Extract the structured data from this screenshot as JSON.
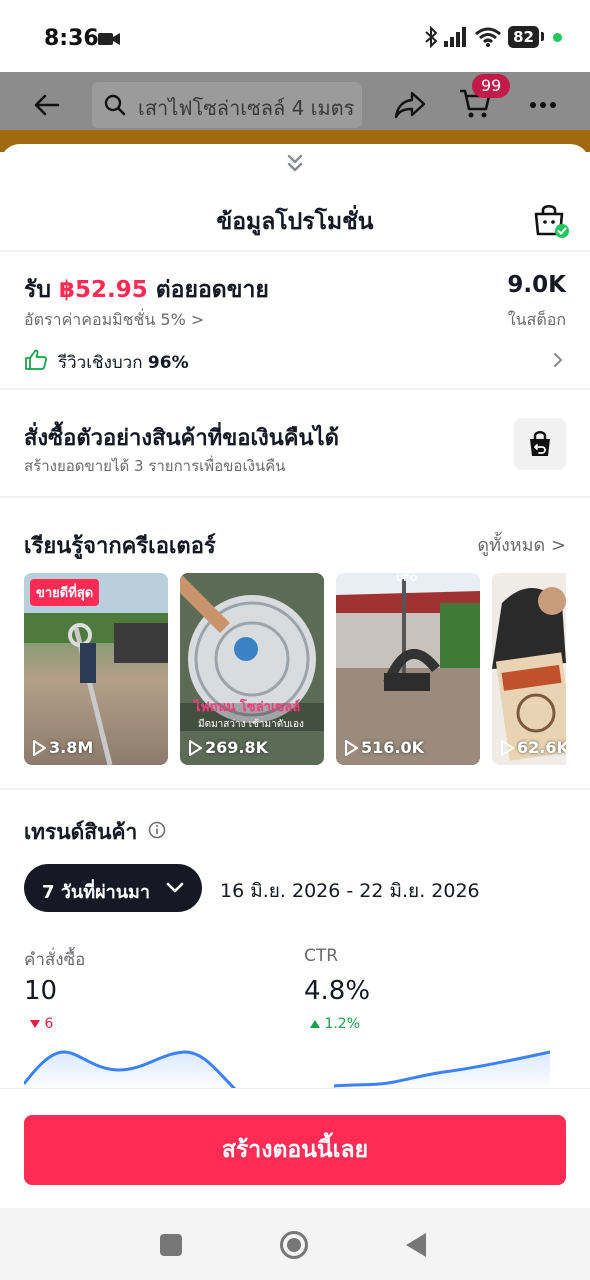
{
  "status_bar": {
    "time": "8:36",
    "battery": "82",
    "icons": [
      "camera-icon",
      "bluetooth-icon",
      "signal-icon",
      "wifi-icon",
      "battery-icon"
    ]
  },
  "top_nav": {
    "search_text": "เสาไฟโซล่าเซลล์ 4 เมตร",
    "cart_badge": "99",
    "icons": [
      "back-icon",
      "search-icon",
      "share-icon",
      "cart-icon",
      "more-icon"
    ]
  },
  "sheet": {
    "title": "ข้อมูลโปรโมชั่น",
    "earn_prefix": "รับ ",
    "earn_amount": "฿52.95",
    "earn_suffix": " ต่อยอดขาย",
    "commission": "อัตราค่าคอมมิชชั่น 5% >",
    "stock_count": "9.0K",
    "stock_label": "ในสต็อก",
    "review_label": "รีวิวเชิงบวก ",
    "review_pct": "96%"
  },
  "sample": {
    "title": "สั่งซื้อตัวอย่างสินค้าที่ขอเงินคืนได้",
    "subtitle": "สร้างยอดขายได้ 3 รายการเพื่อขอเงินคืน"
  },
  "creators": {
    "title": "เรียนรู้จากครีเอเตอร์",
    "see_all": "ดูทั้งหมด >",
    "bestseller_badge": "ขายดีที่สุด",
    "videos": [
      {
        "views": "3.8M"
      },
      {
        "views": "269.8K"
      },
      {
        "views": "516.0K"
      },
      {
        "views": "62.6K"
      }
    ]
  },
  "trend": {
    "title": "เทรนด์สินค้า",
    "period": "7 วันที่ผ่านมา",
    "date_range": "16 มิ.ย. 2026 - 22 มิ.ย. 2026",
    "metrics": [
      {
        "label": "คำสั่งซื้อ",
        "value": "10",
        "change": "6",
        "direction": "down"
      },
      {
        "label": "CTR",
        "value": "4.8%",
        "change": "1.2%",
        "direction": "up"
      }
    ]
  },
  "cta": {
    "label": "สร้างตอนนี้เลย"
  },
  "colors": {
    "accent": "#fe2c55",
    "down": "#e11d48",
    "up": "#16a34a",
    "line": "#3b82f6"
  }
}
